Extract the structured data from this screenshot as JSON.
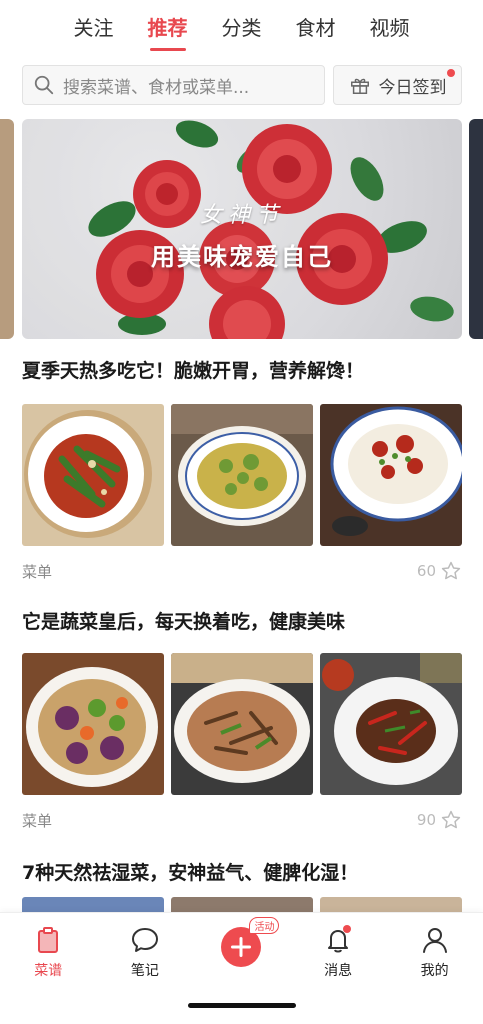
{
  "top_tabs": [
    {
      "label": "关注",
      "active": false
    },
    {
      "label": "推荐",
      "active": true
    },
    {
      "label": "分类",
      "active": false
    },
    {
      "label": "食材",
      "active": false
    },
    {
      "label": "视频",
      "active": false
    }
  ],
  "search": {
    "placeholder": "搜索菜谱、食材或菜单..."
  },
  "checkin": {
    "label": "今日签到"
  },
  "banner": {
    "script_text": "女神节",
    "title": "用美味宠爱自己"
  },
  "sections": [
    {
      "title": "夏季天热多吃它！脆嫩开胃，营养解馋！",
      "tag": "菜单",
      "likes": "60"
    },
    {
      "title": "它是蔬菜皇后，每天换着吃，健康美味",
      "tag": "菜单",
      "likes": "90"
    },
    {
      "title": "7种天然祛湿菜，安神益气、健脾化湿！"
    }
  ],
  "bottom_nav": {
    "items": [
      {
        "label": "菜谱",
        "icon": "clipboard-icon",
        "active": true
      },
      {
        "label": "笔记",
        "icon": "chat-bubble-icon",
        "active": false
      },
      {
        "label": "",
        "icon": "plus-icon",
        "badge": "活动"
      },
      {
        "label": "消息",
        "icon": "bell-icon",
        "active": false
      },
      {
        "label": "我的",
        "icon": "user-icon",
        "active": false
      }
    ]
  },
  "colors": {
    "accent": "#e8484f",
    "text": "#222222",
    "muted": "#888888"
  }
}
